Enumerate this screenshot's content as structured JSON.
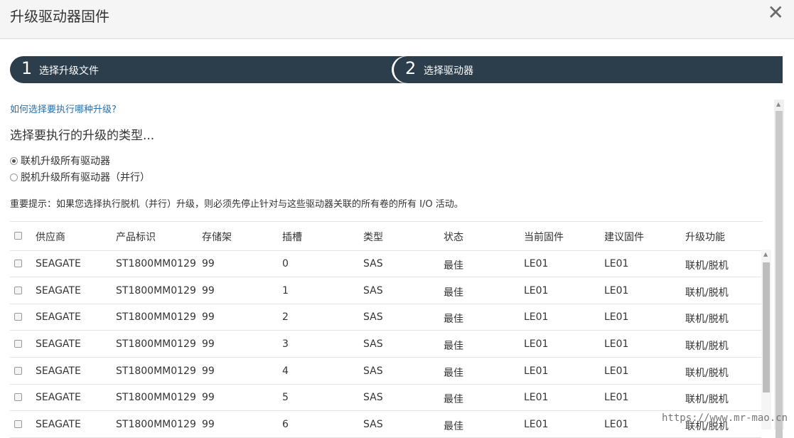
{
  "dialog": {
    "title": "升级驱动器固件",
    "close_icon": "close-icon"
  },
  "wizard": {
    "steps": [
      {
        "number": "1",
        "label": "选择升级文件"
      },
      {
        "number": "2",
        "label": "选择驱动器"
      }
    ]
  },
  "content": {
    "help_link": "如何选择要执行哪种升级?",
    "section_title": "选择要执行的升级的类型...",
    "options": [
      {
        "label": "联机升级所有驱动器",
        "selected": true
      },
      {
        "label": "脱机升级所有驱动器（并行）",
        "selected": false
      }
    ],
    "note": "重要提示：如果您选择执行脱机（并行）升级，则必须先停止针对与这些驱动器关联的所有卷的所有 I/O 活动。"
  },
  "table": {
    "columns": [
      "供应商",
      "产品标识",
      "存储架",
      "插槽",
      "类型",
      "状态",
      "当前固件",
      "建议固件",
      "升级功能"
    ],
    "rows": [
      [
        "SEAGATE",
        "ST1800MM0129",
        "99",
        "0",
        "SAS",
        "最佳",
        "LE01",
        "LE01",
        "联机/脱机"
      ],
      [
        "SEAGATE",
        "ST1800MM0129",
        "99",
        "1",
        "SAS",
        "最佳",
        "LE01",
        "LE01",
        "联机/脱机"
      ],
      [
        "SEAGATE",
        "ST1800MM0129",
        "99",
        "2",
        "SAS",
        "最佳",
        "LE01",
        "LE01",
        "联机/脱机"
      ],
      [
        "SEAGATE",
        "ST1800MM0129",
        "99",
        "3",
        "SAS",
        "最佳",
        "LE01",
        "LE01",
        "联机/脱机"
      ],
      [
        "SEAGATE",
        "ST1800MM0129",
        "99",
        "4",
        "SAS",
        "最佳",
        "LE01",
        "LE01",
        "联机/脱机"
      ],
      [
        "SEAGATE",
        "ST1800MM0129",
        "99",
        "5",
        "SAS",
        "最佳",
        "LE01",
        "LE01",
        "联机/脱机"
      ],
      [
        "SEAGATE",
        "ST1800MM0129",
        "99",
        "6",
        "SAS",
        "最佳",
        "LE01",
        "LE01",
        "联机/脱机"
      ]
    ]
  },
  "watermark": "https://www.mr-mao.cn",
  "colors": {
    "wizard_bg": "#2c3e4c",
    "link": "#2a6fa8"
  }
}
